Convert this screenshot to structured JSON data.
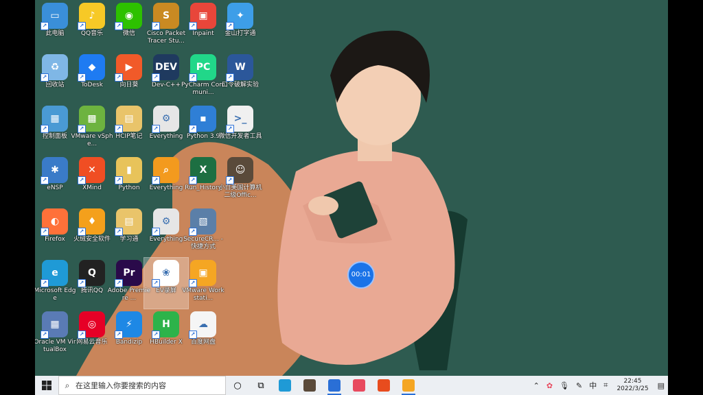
{
  "desktop": {
    "icons": [
      {
        "label": "此电脑",
        "color": "#3a8fd9",
        "glyph": "▭"
      },
      {
        "label": "QQ音乐",
        "color": "#f7c926",
        "glyph": "♪"
      },
      {
        "label": "微信",
        "color": "#2dc100",
        "glyph": "◉"
      },
      {
        "label": "Cisco Packet Tracer Stu...",
        "color": "#c98a22",
        "glyph": "S"
      },
      {
        "label": "Inpaint",
        "color": "#e8463a",
        "glyph": "▣"
      },
      {
        "label": "金山打字通",
        "color": "#3d9ee8",
        "glyph": "✦"
      },
      {
        "label": "回收站",
        "color": "#7fb7e6",
        "glyph": "♻"
      },
      {
        "label": "ToDesk",
        "color": "#1e7bf2",
        "glyph": "◆"
      },
      {
        "label": "向日葵",
        "color": "#f15a29",
        "glyph": "▶"
      },
      {
        "label": "Dev-C++",
        "color": "#1f3a5f",
        "glyph": "DEV"
      },
      {
        "label": "PyCharm Communi...",
        "color": "#21d789",
        "glyph": "PC"
      },
      {
        "label": "口令破解实验",
        "color": "#2b579a",
        "glyph": "W"
      },
      {
        "label": "控制面板",
        "color": "#4a9ad4",
        "glyph": "▦"
      },
      {
        "label": "VMware vSphe...",
        "color": "#6db33f",
        "glyph": "▩"
      },
      {
        "label": "HCIP笔记",
        "color": "#e9c46a",
        "glyph": "▤"
      },
      {
        "label": "Everything",
        "color": "#e6e6e6",
        "glyph": "⚙"
      },
      {
        "label": "Python 3.9",
        "color": "#2f7fd6",
        "glyph": "▪"
      },
      {
        "label": "微信开发者工具",
        "color": "#f0f0f0",
        "glyph": ">_"
      },
      {
        "label": "eNSP",
        "color": "#3a7bc8",
        "glyph": "✱"
      },
      {
        "label": "XMind",
        "color": "#f04e23",
        "glyph": "✕"
      },
      {
        "label": "Python",
        "color": "#e8c35a",
        "glyph": "▮"
      },
      {
        "label": "Everything",
        "color": "#f39a1e",
        "glyph": "⌕"
      },
      {
        "label": "Run_History",
        "color": "#1d6f42",
        "glyph": "X"
      },
      {
        "label": "小白美国计算机二级Offic...",
        "color": "#5a4a3a",
        "glyph": "☺"
      },
      {
        "label": "Firefox",
        "color": "#ff7139",
        "glyph": "◐"
      },
      {
        "label": "火绒安全软件",
        "color": "#f4a01c",
        "glyph": "♦"
      },
      {
        "label": "学习通",
        "color": "#e9c46a",
        "glyph": "▤"
      },
      {
        "label": "Everything",
        "color": "#e6e6e6",
        "glyph": "⚙"
      },
      {
        "label": "SecureCR... - 快捷方式",
        "color": "#5b7fa8",
        "glyph": "▧"
      },
      {
        "label": "Microsoft Edge",
        "color": "#1f9ad6",
        "glyph": "e"
      },
      {
        "label": "腾讯QQ",
        "color": "#222222",
        "glyph": "Q"
      },
      {
        "label": "Adobe Premiere ...",
        "color": "#2a0a4a",
        "glyph": "Pr"
      },
      {
        "label": "EV录屏",
        "color": "#ffffff",
        "glyph": "❀"
      },
      {
        "label": "VMware Workstati...",
        "color": "#f5a623",
        "glyph": "▣"
      },
      {
        "label": "Oracle VM VirtualBox",
        "color": "#5a7bb5",
        "glyph": "▦"
      },
      {
        "label": "网易云音乐",
        "color": "#e60026",
        "glyph": "◎"
      },
      {
        "label": "Bandizip",
        "color": "#1e88e5",
        "glyph": "⚡"
      },
      {
        "label": "HBuilder X",
        "color": "#2db34a",
        "glyph": "H"
      },
      {
        "label": "百度网盘",
        "color": "#f5f5f5",
        "glyph": "☁"
      }
    ]
  },
  "recording": {
    "timer": "00:01"
  },
  "taskbar": {
    "search_placeholder": "在这里输入你要搜索的内容",
    "apps": [
      {
        "name": "edge",
        "color": "#1f9ad6"
      },
      {
        "name": "avatar",
        "color": "#5a4a3a"
      },
      {
        "name": "store",
        "color": "#2a6fd6"
      },
      {
        "name": "recorder",
        "color": "#e84a5f"
      },
      {
        "name": "office",
        "color": "#e84c1e"
      },
      {
        "name": "vmware",
        "color": "#f5a623"
      }
    ],
    "tray": {
      "ime": "中",
      "time": "22:45",
      "date": "2022/3/25"
    }
  }
}
